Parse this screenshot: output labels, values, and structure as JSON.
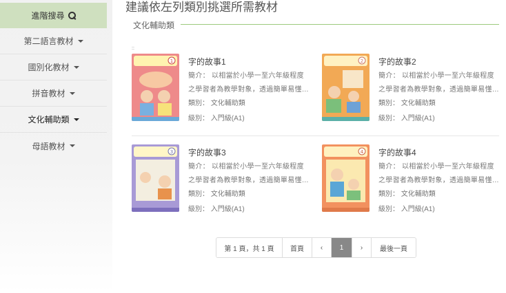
{
  "sidebar": {
    "search_label": "進階搜尋",
    "items": [
      {
        "label": "第二語言教材",
        "active": false
      },
      {
        "label": "國別化教材",
        "active": false
      },
      {
        "label": "拼音教材",
        "active": false
      },
      {
        "label": "文化輔助類",
        "active": true
      },
      {
        "label": "母語教材",
        "active": false
      }
    ]
  },
  "main": {
    "heading": "建議依左列類別挑選所需教材",
    "section_title": "文化輔助類",
    "tiny_mark": "::",
    "books": [
      {
        "title": "字的故事1",
        "desc": "簡介： 以相當於小學一至六年級程度之學習者為教學對象，透過簡單易懂…",
        "category": "類別： 文化輔助類",
        "level": "級別： 入門級(A1)",
        "cover_color": "#ee8a8a",
        "cover_number": "1"
      },
      {
        "title": "字的故事2",
        "desc": "簡介： 以相當於小學一至六年級程度之學習者為教學對象，透過簡單易懂…",
        "category": "類別： 文化輔助類",
        "level": "級別： 入門級(A1)",
        "cover_color": "#f2a955",
        "cover_number": "2"
      },
      {
        "title": "字的故事3",
        "desc": "簡介： 以相當於小學一至六年級程度之學習者為教學對象，透過簡單易懂…",
        "category": "類別： 文化輔助類",
        "level": "級別： 入門級(A1)",
        "cover_color": "#a89ad6",
        "cover_number": "3"
      },
      {
        "title": "字的故事4",
        "desc": "簡介： 以相當於小學一至六年級程度之學習者為教學對象，透過簡單易懂…",
        "category": "類別： 文化輔助類",
        "level": "級別： 入門級(A1)",
        "cover_color": "#f2915f",
        "cover_number": "4"
      }
    ]
  },
  "pagination": {
    "info": "第 1 頁，共 1 頁",
    "first": "首頁",
    "prev": "‹",
    "current": "1",
    "next": "›",
    "last": "最後一頁"
  },
  "colors": {
    "accent_green": "#cfe0bf",
    "divider_green": "#9cc97c",
    "current_page": "#888888"
  }
}
